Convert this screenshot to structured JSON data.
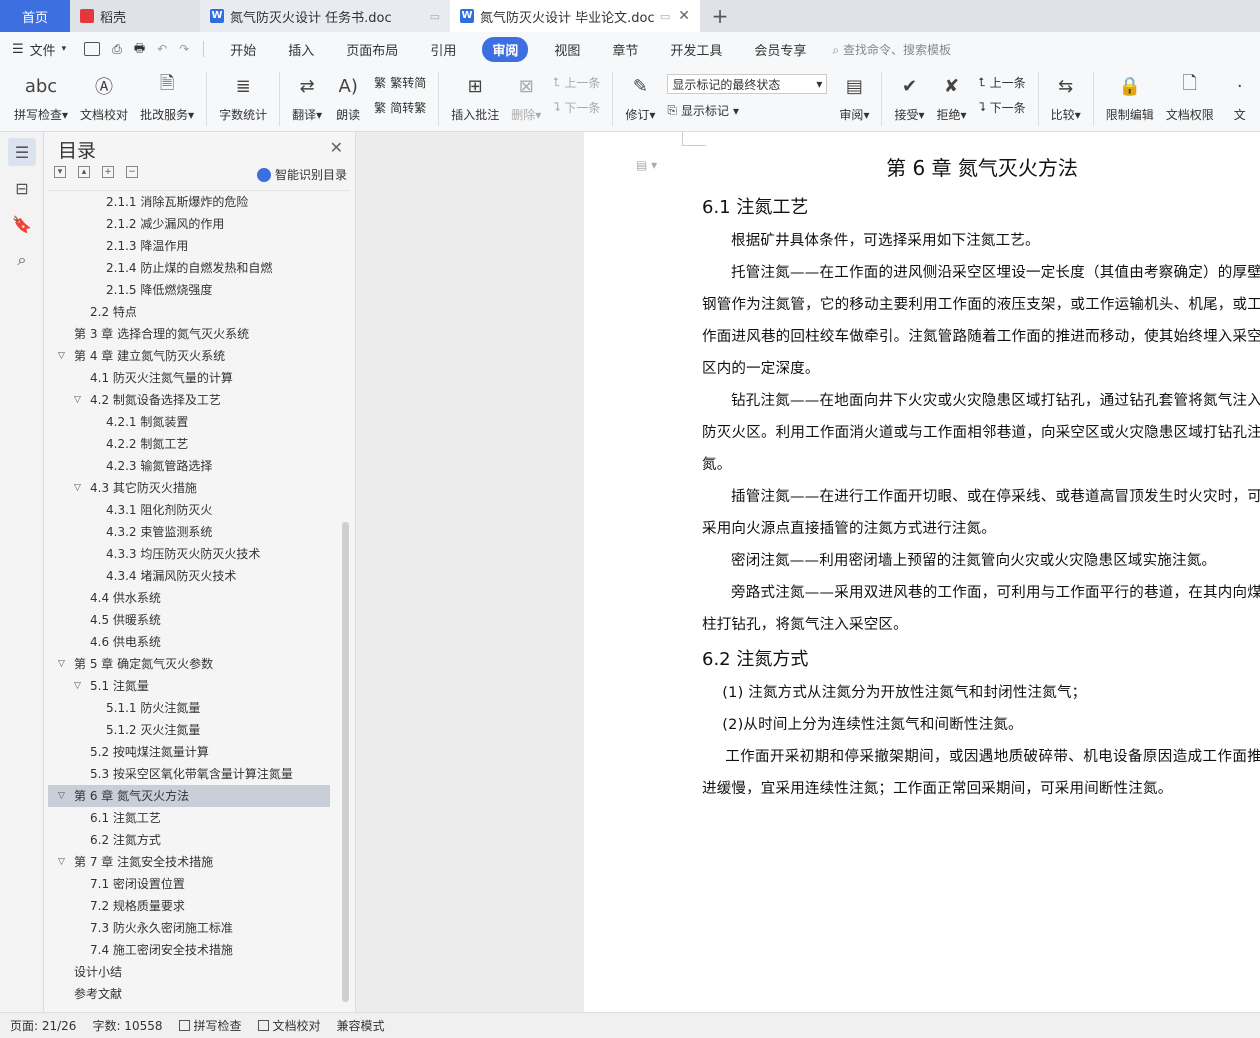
{
  "tabs": {
    "home": "首页",
    "daoke": "稻壳",
    "doc1": "氮气防灭火设计 任务书.doc",
    "doc2": "氮气防灭火设计 毕业论文.doc"
  },
  "menu": {
    "file": "文件",
    "items": [
      "开始",
      "插入",
      "页面布局",
      "引用",
      "审阅",
      "视图",
      "章节",
      "开发工具",
      "会员专享"
    ],
    "active": "审阅",
    "search": "查找命令、搜索模板"
  },
  "toolbar": {
    "spell": "拼写检查",
    "proofread": "文档校对",
    "annotate_service": "批改服务",
    "wordcount": "字数统计",
    "translate": "翻译",
    "read_aloud": "朗读",
    "trad_conv": "繁转简",
    "simp_conv": "简转繁",
    "insert_comment": "插入批注",
    "delete": "删除",
    "prev": "上一条",
    "next": "下一条",
    "revise": "修订",
    "display_state": "显示标记的最终状态",
    "show_marks": "显示标记",
    "review": "审阅",
    "accept": "接受",
    "reject": "拒绝",
    "prev2": "上一条",
    "next2": "下一条",
    "compare": "比较",
    "restrict": "限制编辑",
    "doc_perm": "文档权限",
    "doc_more": "文"
  },
  "toc": {
    "title": "目录",
    "smart": "智能识别目录",
    "items": [
      {
        "label": "2.1.1 消除瓦斯爆炸的危险",
        "level": 3
      },
      {
        "label": "2.1.2 减少漏风的作用",
        "level": 3
      },
      {
        "label": "2.1.3 降温作用",
        "level": 3
      },
      {
        "label": "2.1.4 防止煤的自燃发热和自燃",
        "level": 3
      },
      {
        "label": "2.1.5 降低燃烧强度",
        "level": 3
      },
      {
        "label": "2.2 特点",
        "level": 2
      },
      {
        "label": "第 3 章  选择合理的氮气灭火系统",
        "level": 1
      },
      {
        "label": "第 4 章  建立氮气防灭火系统",
        "level": 1,
        "arrow": true
      },
      {
        "label": "4.1 防灭火注氮气量的计算",
        "level": 2
      },
      {
        "label": "4.2 制氮设备选择及工艺",
        "level": 2,
        "arrow": true
      },
      {
        "label": "4.2.1 制氮装置",
        "level": 3
      },
      {
        "label": "4.2.2 制氮工艺",
        "level": 3
      },
      {
        "label": "4.2.3 输氮管路选择",
        "level": 3
      },
      {
        "label": "4.3 其它防灭火措施",
        "level": 2,
        "arrow": true
      },
      {
        "label": "4.3.1 阻化剂防灭火",
        "level": 3
      },
      {
        "label": "4.3.2 束管监测系统",
        "level": 3
      },
      {
        "label": "4.3.3 均压防灭火防灭火技术",
        "level": 3
      },
      {
        "label": "4.3.4 堵漏风防灭火技术",
        "level": 3
      },
      {
        "label": "4.4 供水系统",
        "level": 2
      },
      {
        "label": "4.5 供暖系统",
        "level": 2
      },
      {
        "label": "4.6 供电系统",
        "level": 2
      },
      {
        "label": "第 5 章  确定氮气灭火参数",
        "level": 1,
        "arrow": true
      },
      {
        "label": "5.1 注氮量",
        "level": 2,
        "arrow": true
      },
      {
        "label": "5.1.1 防火注氮量",
        "level": 3
      },
      {
        "label": "5.1.2 灭火注氮量",
        "level": 3
      },
      {
        "label": "5.2 按吨煤注氮量计算",
        "level": 2
      },
      {
        "label": "5.3 按采空区氧化带氧含量计算注氮量",
        "level": 2
      },
      {
        "label": "第 6 章  氮气灭火方法",
        "level": 1,
        "arrow": true,
        "selected": true
      },
      {
        "label": "6.1 注氮工艺",
        "level": 2
      },
      {
        "label": "6.2 注氮方式",
        "level": 2
      },
      {
        "label": "第 7 章  注氮安全技术措施",
        "level": 1,
        "arrow": true
      },
      {
        "label": "7.1 密闭设置位置",
        "level": 2
      },
      {
        "label": "7.2 规格质量要求",
        "level": 2
      },
      {
        "label": "7.3 防火永久密闭施工标准",
        "level": 2
      },
      {
        "label": "7.4 施工密闭安全技术措施",
        "level": 2
      },
      {
        "label": "设计小结",
        "level": 1
      },
      {
        "label": "参考文献",
        "level": 1
      }
    ]
  },
  "document": {
    "chapter": "第 6 章  氮气灭火方法",
    "sec1": "6.1 注氮工艺",
    "p1": "根据矿井具体条件，可选择采用如下注氮工艺。",
    "p2": "托管注氮——在工作面的进风侧沿采空区埋设一定长度（其值由考察确定）的厚壁钢管作为注氮管，它的移动主要利用工作面的液压支架，或工作运输机头、机尾，或工作面进风巷的回柱绞车做牵引。注氮管路随着工作面的推进而移动，使其始终埋入采空区内的一定深度。",
    "p3": "钻孔注氮——在地面向井下火灾或火灾隐患区域打钻孔，通过钻孔套管将氮气注入防灭火区。利用工作面消火道或与工作面相邻巷道，向采空区或火灾隐患区域打钻孔注氮。",
    "p4": "插管注氮——在进行工作面开切眼、或在停采线、或巷道高冒顶发生时火灾时，可采用向火源点直接插管的注氮方式进行注氮。",
    "p5": "密闭注氮——利用密闭墙上预留的注氮管向火灾或火灾隐患区域实施注氮。",
    "p6": "旁路式注氮——采用双进风巷的工作面，可利用与工作面平行的巷道，在其内向煤柱打钻孔，将氮气注入采空区。",
    "sec2": "6.2 注氮方式",
    "p7": "(1)  注氮方式从注氮分为开放性注氮气和封闭性注氮气；",
    "p8": "(2)从时间上分为连续性注氮气和间断性注氮。",
    "p9": "工作面开采初期和停采撤架期间，或因遇地质破碎带、机电设备原因造成工作面推进缓慢，宜采用连续性注氮；工作面正常回采期间，可采用间断性注氮。"
  },
  "status": {
    "page": "页面: 21/26",
    "words": "字数: 10558",
    "spell": "拼写检查",
    "proof": "文档校对",
    "compat": "兼容模式"
  }
}
